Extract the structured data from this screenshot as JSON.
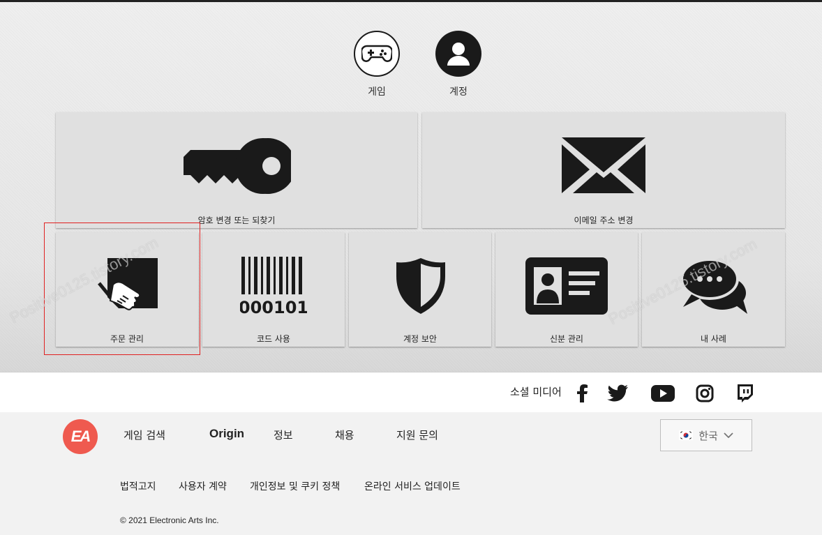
{
  "nav": {
    "games_label": "게임",
    "account_label": "계정"
  },
  "tiles": {
    "password": "암호 변경 또는 되찾기",
    "email": "이메일 주소 변경",
    "orders": "주문 관리",
    "redeem": "코드 사용",
    "barcode_text": "000101",
    "security": "계정 보안",
    "identity": "신분 관리",
    "cases": "내 사례"
  },
  "watermark": "Positive0125.tistory.com",
  "social": {
    "label": "소셜 미디어",
    "icons": [
      "facebook-icon",
      "twitter-icon",
      "youtube-icon",
      "instagram-icon",
      "twitch-icon"
    ]
  },
  "footer": {
    "logo_text": "EA",
    "links": {
      "game_search": "게임 검색",
      "origin": "Origin",
      "info": "정보",
      "careers": "채용",
      "support": "지원 문의"
    },
    "language": "한국",
    "legal": {
      "notice": "법적고지",
      "user_agreement": "사용자 계약",
      "privacy": "개인정보 및 쿠키 정책",
      "online_updates": "온라인 서비스 업데이트"
    },
    "copyright": "© 2021 Electronic Arts Inc."
  },
  "colors": {
    "ea_red": "#ef5a4f",
    "highlight_red": "#e02020",
    "icon_dark": "#1a1a1a"
  }
}
